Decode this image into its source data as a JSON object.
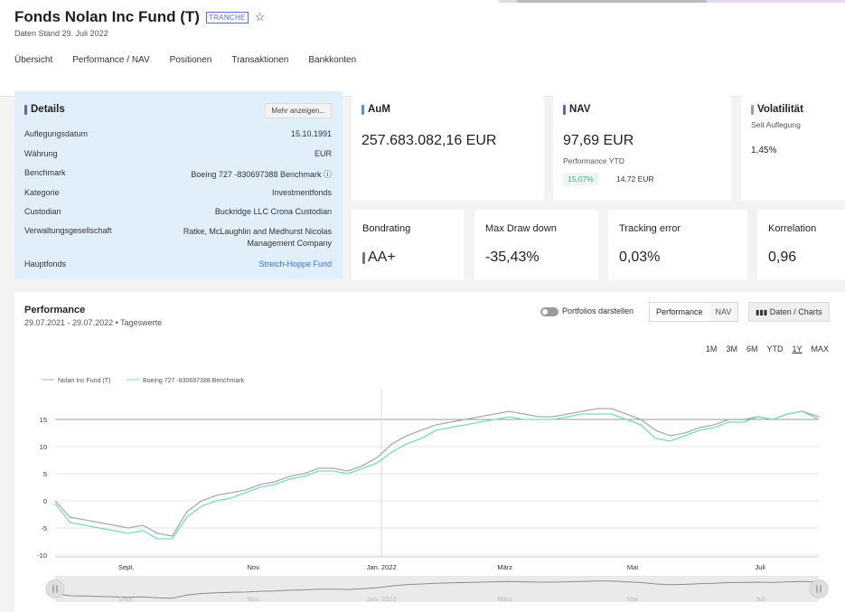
{
  "header": {
    "title": "Fonds Nolan Inc Fund (T)",
    "badge": "TRANCHE",
    "star_icon": "star-icon",
    "date_text": "Daten Stand 29. Juli 2022"
  },
  "tabs": [
    "Übersicht",
    "Performance / NAV",
    "Positionen",
    "Transaktionen",
    "Bankkonten"
  ],
  "details": {
    "title": "Details",
    "more_label": "Mehr anzeigen...",
    "rows": [
      {
        "label": "Auflegungsdatum",
        "value": "15.10.1991"
      },
      {
        "label": "Währung",
        "value": "EUR"
      },
      {
        "label": "Benchmark",
        "value": "Boeing 727 -830697388 Benchmark"
      },
      {
        "label": "Kategorie",
        "value": "Investmentfonds"
      },
      {
        "label": "Custodian",
        "value": "Buckridge LLC Crona Custodian"
      },
      {
        "label": "Verwaltungsgesellschaft",
        "value": "Ratke, McLaughlin and Medhurst Nicolas Management Company"
      },
      {
        "label": "Hauptfonds",
        "value": "Streich-Hoppe Fund"
      }
    ]
  },
  "aum": {
    "title": "AuM",
    "value": "257.683.082,16 EUR"
  },
  "nav": {
    "title": "NAV",
    "value": "97,69 EUR",
    "ytd_label": "Performance YTD",
    "ytd_pct": "15,07%",
    "ytd_abs": "14,72 EUR"
  },
  "volatility": {
    "title": "Volatilität",
    "subtitle": "Seit Auflegung",
    "value": "1,45%"
  },
  "kpis": [
    {
      "title": "Bondrating",
      "value": "AA+"
    },
    {
      "title": "Max Draw down",
      "value": "-35,43%"
    },
    {
      "title": "Tracking error",
      "value": "0,03%"
    },
    {
      "title": "Korrelation",
      "value": "0,96"
    }
  ],
  "performance": {
    "title": "Performance",
    "subtitle": "29.07.2021 - 29.07.2022  •  Tageswerte",
    "toggle_label": "Portfolios darstellen",
    "seg_performance": "Performance",
    "seg_nav": "NAV",
    "charts_button": "Daten / Charts",
    "ranges": [
      "1M",
      "3M",
      "6M",
      "YTD",
      "1Y",
      "MAX"
    ],
    "selected_range": "1Y"
  },
  "colors": {
    "fund": "#aaaaaa",
    "benchmark": "#7dd9b6",
    "details_bg": "#e1effb",
    "link": "#3d6fd1",
    "accent_purple": "#6a5acd",
    "accent_pink": "#c97fc9"
  },
  "chart_data": {
    "type": "line",
    "x": [
      "2021-07-29",
      "2021-08-05",
      "2021-08-12",
      "2021-08-19",
      "2021-08-26",
      "2021-09-02",
      "2021-09-09",
      "2021-09-16",
      "2021-09-23",
      "2021-09-30",
      "2021-10-07",
      "2021-10-14",
      "2021-10-21",
      "2021-10-28",
      "2021-11-04",
      "2021-11-11",
      "2021-11-18",
      "2021-11-25",
      "2021-12-02",
      "2021-12-09",
      "2021-12-16",
      "2021-12-23",
      "2021-12-30",
      "2022-01-06",
      "2022-01-13",
      "2022-01-20",
      "2022-01-27",
      "2022-02-03",
      "2022-02-10",
      "2022-02-17",
      "2022-02-24",
      "2022-03-03",
      "2022-03-10",
      "2022-03-17",
      "2022-03-24",
      "2022-03-31",
      "2022-04-07",
      "2022-04-14",
      "2022-04-21",
      "2022-04-28",
      "2022-05-05",
      "2022-05-12",
      "2022-05-19",
      "2022-05-26",
      "2022-06-02",
      "2022-06-09",
      "2022-06-16",
      "2022-06-23",
      "2022-06-30",
      "2022-07-07",
      "2022-07-14",
      "2022-07-21",
      "2022-07-29"
    ],
    "series": [
      {
        "name": "Nolan Inc Fund (T)",
        "values": [
          0,
          -3,
          -3.5,
          -4,
          -4.5,
          -5,
          -4.5,
          -6,
          -6.5,
          -2,
          0,
          1,
          1.5,
          2,
          3,
          3.5,
          4.5,
          5,
          6,
          6,
          5.5,
          6.5,
          8,
          10.5,
          12,
          13,
          14,
          14.5,
          15,
          15.5,
          16,
          16.5,
          16,
          15.5,
          15.5,
          16,
          16.5,
          17,
          17,
          16,
          15,
          13,
          12,
          12.5,
          13.5,
          14,
          15,
          15,
          15.5,
          15,
          16,
          16.5,
          15.5
        ]
      },
      {
        "name": "Boeing 727 -830697388 Benchmark",
        "values": [
          -0.5,
          -4,
          -4.5,
          -5,
          -5.5,
          -6,
          -5.5,
          -7,
          -7,
          -3,
          -1,
          0,
          0.5,
          1.5,
          2.5,
          3,
          4,
          4.5,
          5.5,
          5.5,
          5,
          6,
          7,
          9,
          10.5,
          11.5,
          13,
          13.5,
          14,
          14.5,
          15,
          15.5,
          15,
          15,
          15,
          15.5,
          16,
          16,
          16,
          15,
          14,
          11.5,
          11,
          12,
          13,
          13.5,
          14.5,
          14.5,
          15.5,
          15,
          16,
          16.5,
          15
        ]
      }
    ],
    "x_ticks": [
      "Sept.",
      "Nov.",
      "Jan. 2022",
      "März",
      "Mai",
      "Juli"
    ],
    "y_ticks": [
      "15",
      "10",
      "5",
      "0",
      "-5",
      "-10"
    ],
    "ylim": [
      -10,
      20
    ],
    "reference_line": 15,
    "legend_position": "top-left",
    "grid": true
  }
}
